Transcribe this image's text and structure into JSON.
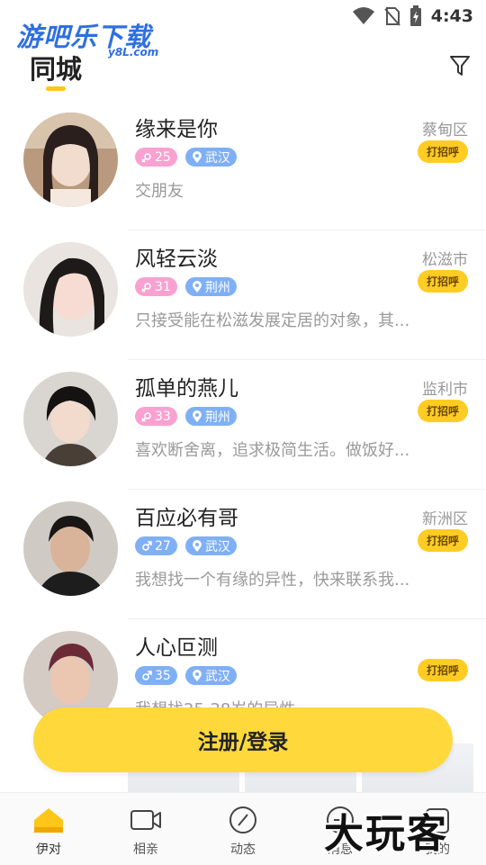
{
  "status": {
    "time": "4:43"
  },
  "watermark": {
    "logo_text": "游吧乐下载",
    "logo_sub": "y8L.com",
    "corner_text": "大玩客"
  },
  "header": {
    "title": "同城"
  },
  "users": [
    {
      "name": "缘来是你",
      "gender": "female",
      "age": "25",
      "city": "武汉",
      "bio": "交朋友",
      "district": "蔡甸区",
      "greet": "打招呼"
    },
    {
      "name": "风轻云淡",
      "gender": "female",
      "age": "31",
      "city": "荆州",
      "bio": "只接受能在松滋发展定居的对象，其...",
      "district": "松滋市",
      "greet": "打招呼"
    },
    {
      "name": "孤单的燕儿",
      "gender": "female",
      "age": "33",
      "city": "荆州",
      "bio": "喜欢断舍离，追求极简生活。做饭好...",
      "district": "监利市",
      "greet": "打招呼"
    },
    {
      "name": "百应必有哥",
      "gender": "male",
      "age": "27",
      "city": "武汉",
      "bio": "我想找一个有缘的异性，快来联系我...",
      "district": "新洲区",
      "greet": "打招呼"
    },
    {
      "name": "人心叵测",
      "gender": "male",
      "age": "35",
      "city": "武汉",
      "bio": "我想找25-38岁的异性",
      "district": "",
      "greet": "打招呼"
    }
  ],
  "cta": {
    "label": "注册/登录"
  },
  "tabs": [
    {
      "label": "伊对",
      "icon": "home-icon"
    },
    {
      "label": "相亲",
      "icon": "video-icon"
    },
    {
      "label": "动态",
      "icon": "compass-icon"
    },
    {
      "label": "消息",
      "icon": "message-icon"
    },
    {
      "label": "我的",
      "icon": "profile-icon"
    }
  ],
  "colors": {
    "accent": "#ffcc24",
    "female_tag": "#f9a1d0",
    "male_tag": "#7fb0f5"
  }
}
